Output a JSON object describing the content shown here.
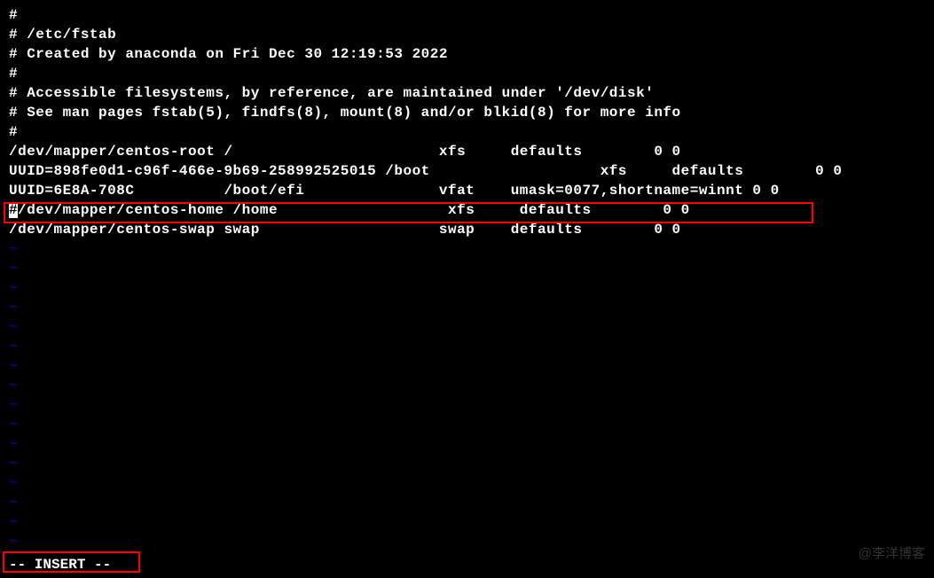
{
  "editor": {
    "lines": {
      "l0": "#",
      "l1": "# /etc/fstab",
      "l2": "# Created by anaconda on Fri Dec 30 12:19:53 2022",
      "l3": "#",
      "l4": "# Accessible filesystems, by reference, are maintained under '/dev/disk'",
      "l5": "# See man pages fstab(5), findfs(8), mount(8) and/or blkid(8) for more info",
      "l6": "#",
      "l7": "/dev/mapper/centos-root /                       xfs     defaults        0 0",
      "l8": "UUID=898fe0d1-c96f-466e-9b69-258992525015 /boot                   xfs     defaults        0 0",
      "l9": "UUID=6E8A-708C          /boot/efi               vfat    umask=0077,shortname=winnt 0 0",
      "l10_cursor": "#",
      "l10_rest": "/dev/mapper/centos-home /home                   xfs     defaults        0 0",
      "l11": "/dev/mapper/centos-swap swap                    swap    defaults        0 0"
    },
    "tilde": "~",
    "mode": "-- INSERT --",
    "watermark": "@李洋博客"
  }
}
